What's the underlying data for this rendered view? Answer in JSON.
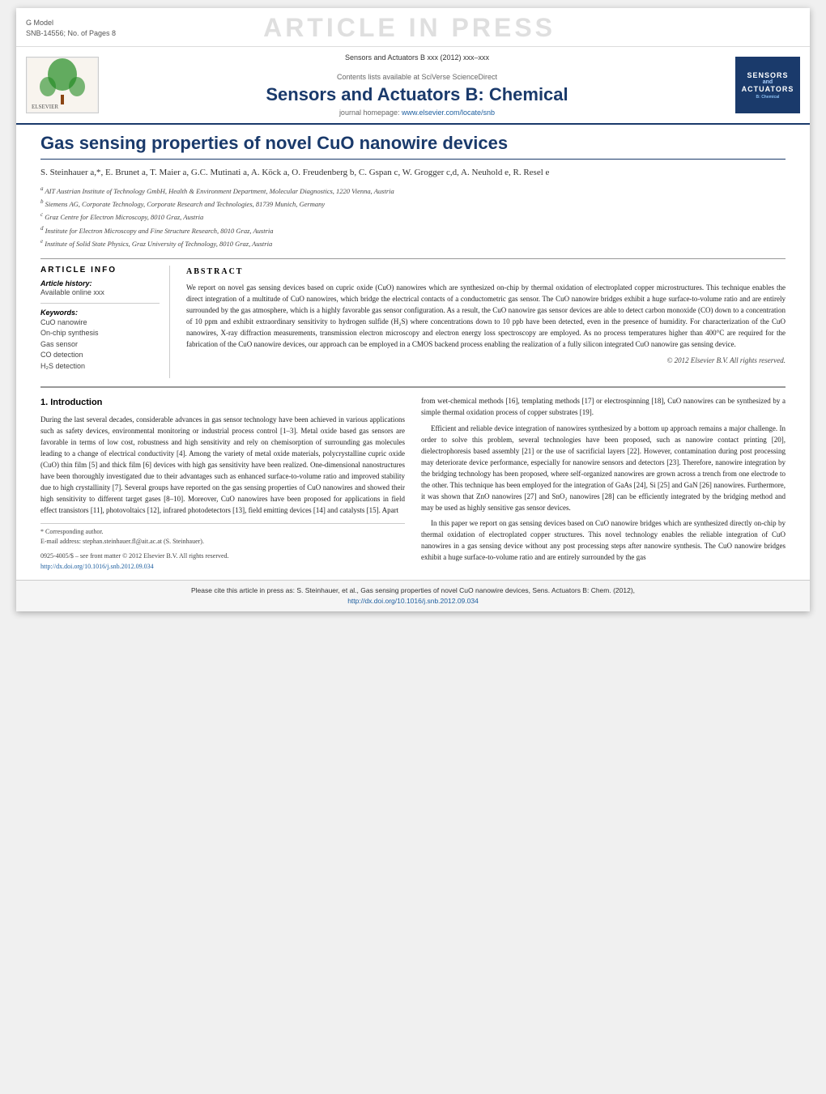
{
  "gmodel": {
    "line1": "G Model",
    "line2": "SNB-14556; No. of Pages 8"
  },
  "article_in_press": "ARTICLE IN PRESS",
  "journal": {
    "doi_display": "Sensors and Actuators B xxx (2012) xxx–xxx",
    "sciverse_text": "Contents lists available at SciVerse ScienceDirect",
    "sciverse_link": "SciVerse ScienceDirect",
    "name": "Sensors and Actuators B: Chemical",
    "homepage_text": "journal homepage: www.elsevier.com/locate/snb",
    "homepage_link": "www.elsevier.com/locate/snb",
    "logo_right_line1": "SENSORS",
    "logo_right_line2": "and",
    "logo_right_line3": "ACTUATORS"
  },
  "article": {
    "title": "Gas sensing properties of novel CuO nanowire devices",
    "authors": "S. Steinhauer a,*, E. Brunet a, T. Maier a, G.C. Mutinati a, A. Köck a, O. Freudenberg b, C. Gspan c, W. Grogger c,d, A. Neuhold e, R. Resel e",
    "affiliations": [
      {
        "id": "a",
        "text": "AIT Austrian Institute of Technology GmbH, Health & Environment Department, Molecular Diagnostics, 1220 Vienna, Austria"
      },
      {
        "id": "b",
        "text": "Siemens AG, Corporate Technology, Corporate Research and Technologies, 81739 Munich, Germany"
      },
      {
        "id": "c",
        "text": "Graz Centre for Electron Microscopy, 8010 Graz, Austria"
      },
      {
        "id": "d",
        "text": "Institute for Electron Microscopy and Fine Structure Research, 8010 Graz, Austria"
      },
      {
        "id": "e",
        "text": "Institute of Solid State Physics, Graz University of Technology, 8010 Graz, Austria"
      }
    ]
  },
  "article_info": {
    "heading": "ARTICLE INFO",
    "history_label": "Article history:",
    "available_label": "Available online xxx",
    "keywords_label": "Keywords:",
    "keywords": [
      "CuO nanowire",
      "On-chip synthesis",
      "Gas sensor",
      "CO detection",
      "H₂S detection"
    ]
  },
  "abstract": {
    "heading": "ABSTRACT",
    "text": "We report on novel gas sensing devices based on cupric oxide (CuO) nanowires which are synthesized on-chip by thermal oxidation of electroplated copper microstructures. This technique enables the direct integration of a multitude of CuO nanowires, which bridge the electrical contacts of a conductometric gas sensor. The CuO nanowire bridges exhibit a huge surface-to-volume ratio and are entirely surrounded by the gas atmosphere, which is a highly favorable gas sensor configuration. As a result, the CuO nanowire gas sensor devices are able to detect carbon monoxide (CO) down to a concentration of 10 ppm and exhibit extraordinary sensitivity to hydrogen sulfide (H₂S) where concentrations down to 10 ppb have been detected, even in the presence of humidity. For characterization of the CuO nanowires, X-ray diffraction measurements, transmission electron microscopy and electron energy loss spectroscopy are employed. As no process temperatures higher than 400°C are required for the fabrication of the CuO nanowire devices, our approach can be employed in a CMOS backend process enabling the realization of a fully silicon integrated CuO nanowire gas sensing device.",
    "copyright": "© 2012 Elsevier B.V. All rights reserved."
  },
  "body": {
    "section1_title": "1.  Introduction",
    "col1_paragraphs": [
      "During the last several decades, considerable advances in gas sensor technology have been achieved in various applications such as safety devices, environmental monitoring or industrial process control [1–3]. Metal oxide based gas sensors are favorable in terms of low cost, robustness and high sensitivity and rely on chemisorption of surrounding gas molecules leading to a change of electrical conductivity [4]. Among the variety of metal oxide materials, polycrystalline cupric oxide (CuO) thin film [5] and thick film [6] devices with high gas sensitivity have been realized. One-dimensional nanostructures have been thoroughly investigated due to their advantages such as enhanced surface-to-volume ratio and improved stability due to high crystallinity [7]. Several groups have reported on the gas sensing properties of CuO nanowires and showed their high sensitivity to different target gases [8–10]. Moreover, CuO nanowires have been proposed for applications in field effect transistors [11], photovoltaics [12], infrared photodetectors [13], field emitting devices [14] and catalysts [15]. Apart"
    ],
    "col2_paragraphs": [
      "from wet-chemical methods [16], templating methods [17] or electrospinning [18], CuO nanowires can be synthesized by a simple thermal oxidation process of copper substrates [19].",
      "Efficient and reliable device integration of nanowires synthesized by a bottom up approach remains a major challenge. In order to solve this problem, several technologies have been proposed, such as nanowire contact printing [20], dielectrophoresis based assembly [21] or the use of sacrificial layers [22]. However, contamination during post processing may deteriorate device performance, especially for nanowire sensors and detectors [23]. Therefore, nanowire integration by the bridging technology has been proposed, where self-organized nanowires are grown across a trench from one electrode to the other. This technique has been employed for the integration of GaAs [24], Si [25] and GaN [26] nanowires. Furthermore, it was shown that ZnO nanowires [27] and SnO₂ nanowires [28] can be efficiently integrated by the bridging method and may be used as highly sensitive gas sensor devices.",
      "In this paper we report on gas sensing devices based on CuO nanowire bridges which are synthesized directly on-chip by thermal oxidation of electroplated copper structures. This novel technology enables the reliable integration of CuO nanowires in a gas sensing device without any post processing steps after nanowire synthesis. The CuO nanowire bridges exhibit a huge surface-to-volume ratio and are entirely surrounded by the gas"
    ],
    "footnote_corresponding": "* Corresponding author.",
    "footnote_email": "E-mail address: stephan.steinhauer.fl@ait.ac.at (S. Steinhauer).",
    "footer_oa": "0925-4005/$ – see front matter © 2012 Elsevier B.V. All rights reserved.",
    "footer_doi": "http://dx.doi.org/10.1016/j.snb.2012.09.034"
  },
  "footer": {
    "cite_text": "Please cite this article in press as: S. Steinhauer, et al., Gas sensing properties of novel CuO nanowire devices, Sens. Actuators B: Chem. (2012),",
    "cite_doi": "http://dx.doi.org/10.1016/j.snb.2012.09.034"
  }
}
